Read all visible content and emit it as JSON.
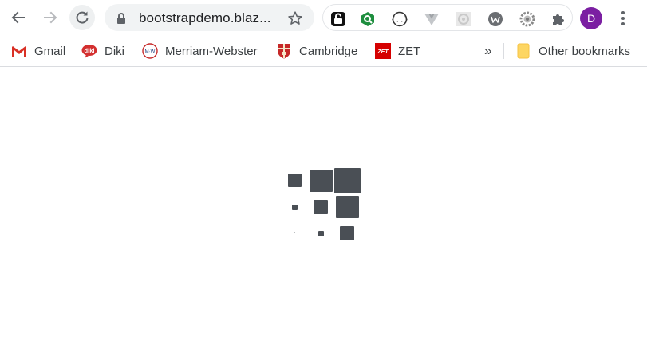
{
  "browser": {
    "url_display": "bootstrapdemo.blaz...",
    "profile_initial": "D",
    "accent_profile": "#7b1fa2"
  },
  "icons": {
    "back": "arrow-left-icon",
    "forward": "arrow-right-icon",
    "reload": "reload-icon",
    "lock": "lock-icon",
    "star": "star-icon",
    "extensions": "puzzle-icon",
    "menu": "kebab-menu-icon"
  },
  "bookmarks": {
    "items": [
      {
        "label": "Gmail",
        "icon": "gmail-icon"
      },
      {
        "label": "Diki",
        "icon": "diki-icon"
      },
      {
        "label": "Merriam-Webster",
        "icon": "merriam-webster-icon"
      },
      {
        "label": "Cambridge",
        "icon": "cambridge-icon"
      },
      {
        "label": "ZET",
        "icon": "zet-icon"
      }
    ],
    "overflow": "»",
    "other": "Other bookmarks"
  },
  "loader": {
    "color": "#4a4f55"
  }
}
